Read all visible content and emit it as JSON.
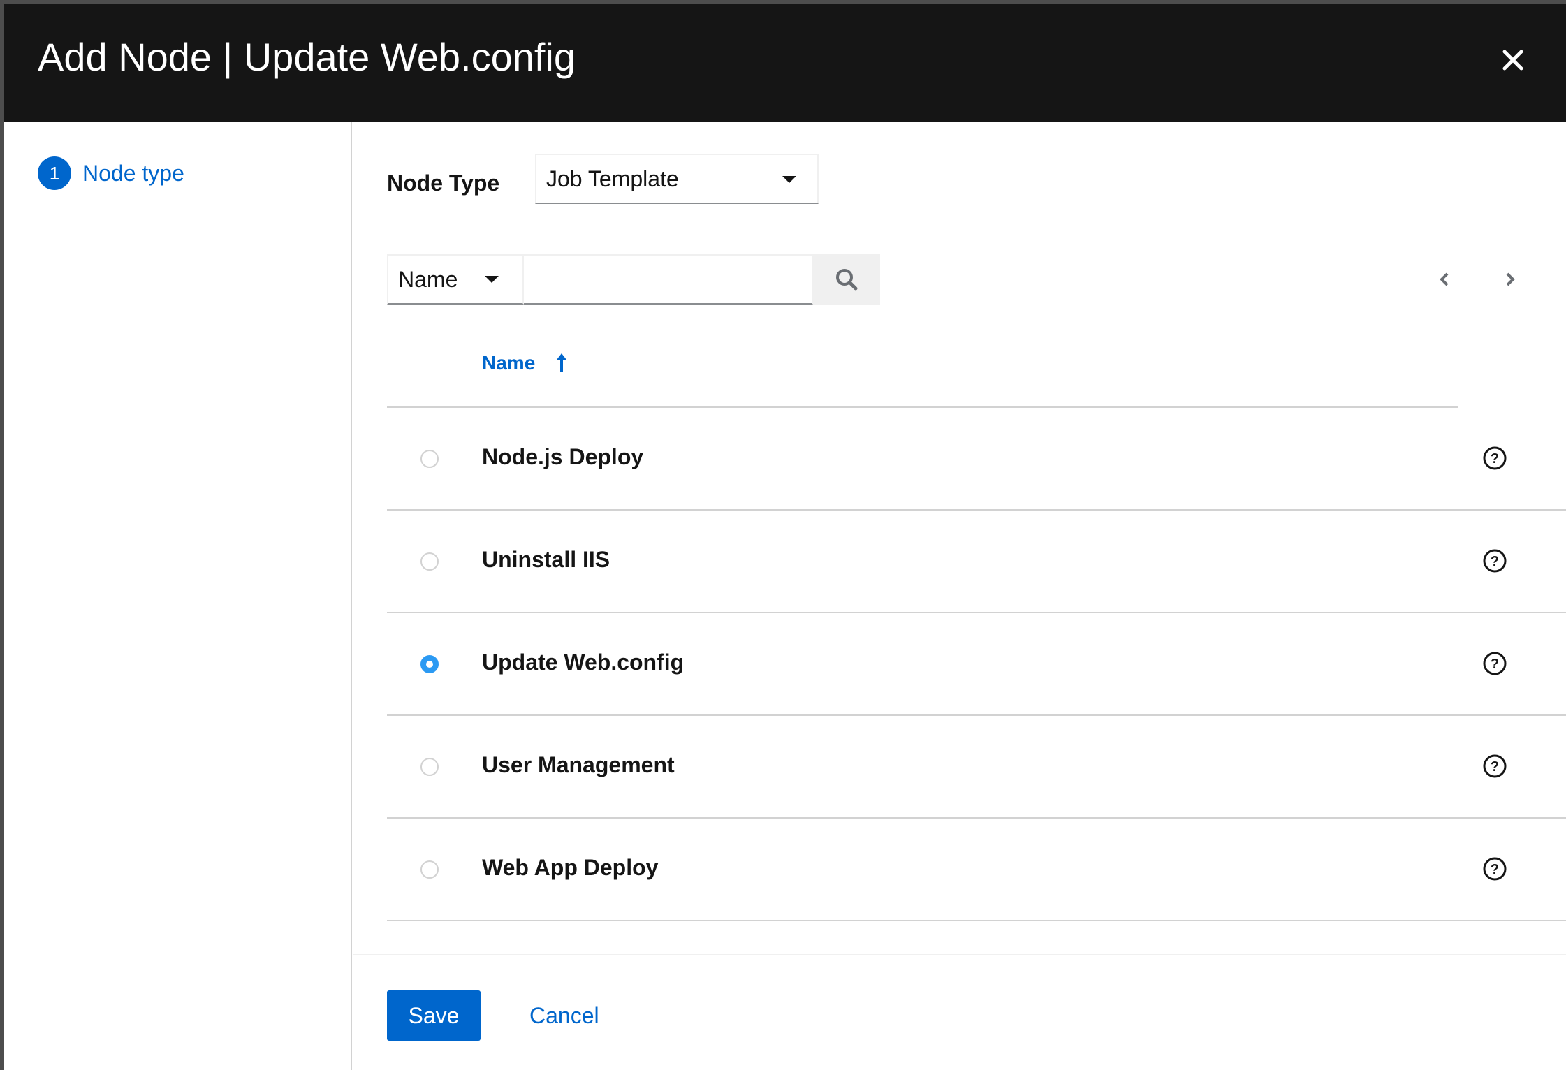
{
  "modal": {
    "title": "Add Node | Update Web.config",
    "close_icon": "close-icon"
  },
  "nav": {
    "steps": [
      {
        "number": "1",
        "label": "Node type"
      }
    ]
  },
  "form": {
    "node_type_label": "Node Type",
    "node_type_value": "Job Template"
  },
  "search": {
    "field_label": "Name",
    "input_value": "",
    "search_icon": "search-icon"
  },
  "pager": {
    "prev_icon": "chevron-left-icon",
    "next_icon": "chevron-right-icon"
  },
  "table": {
    "column_header": "Name",
    "sort_icon": "sort-ascending-icon",
    "rows": [
      {
        "name": "Node.js Deploy",
        "selected": false
      },
      {
        "name": "Uninstall IIS",
        "selected": false
      },
      {
        "name": "Update Web.config",
        "selected": true
      },
      {
        "name": "User Management",
        "selected": false
      },
      {
        "name": "Web App Deploy",
        "selected": false
      }
    ]
  },
  "footer": {
    "save_label": "Save",
    "cancel_label": "Cancel"
  },
  "colors": {
    "accent": "#0066cc",
    "radio_checked": "#2b9af3",
    "header_bg": "#151515"
  }
}
